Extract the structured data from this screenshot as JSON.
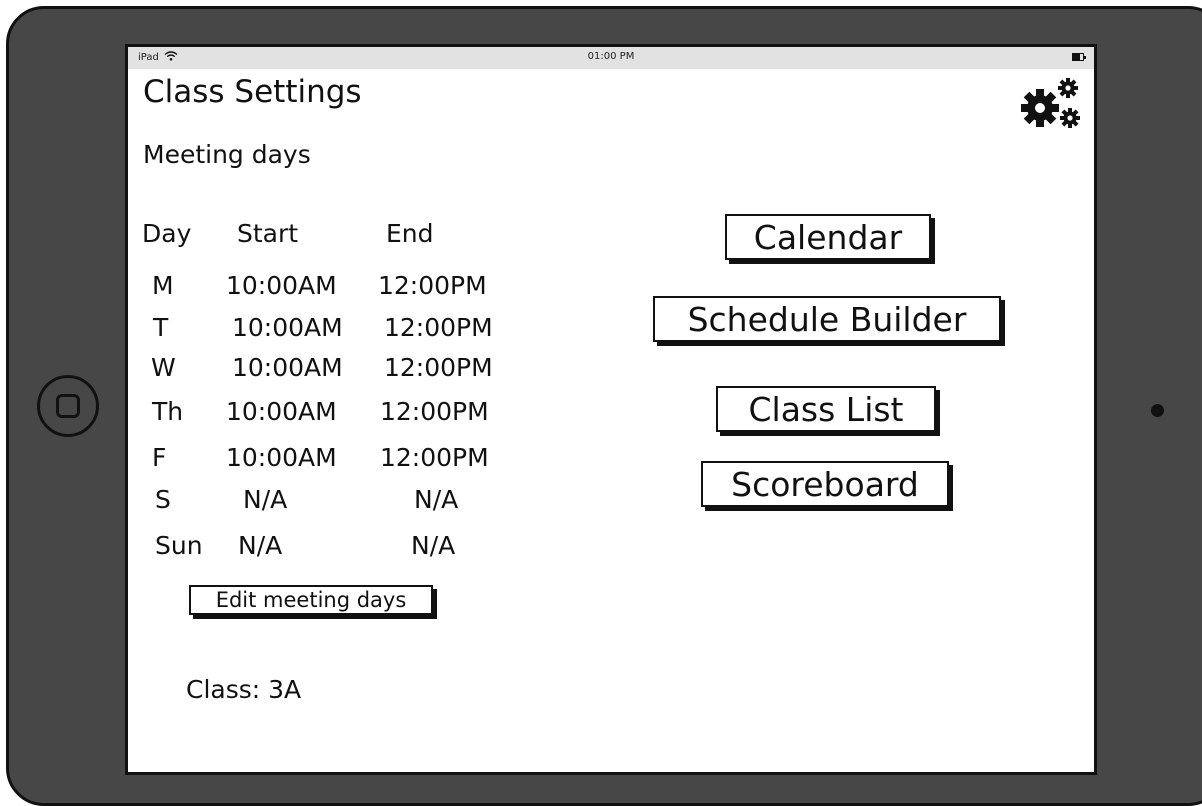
{
  "status_bar": {
    "carrier": "iPad",
    "time": "01:00 PM"
  },
  "header": {
    "title": "Class Settings"
  },
  "meeting": {
    "section_title": "Meeting days",
    "columns": [
      "Day",
      "Start",
      "End"
    ],
    "rows": [
      {
        "day": "M",
        "start": "10:00AM",
        "end": "12:00PM"
      },
      {
        "day": "T",
        "start": "10:00AM",
        "end": "12:00PM"
      },
      {
        "day": "W",
        "start": "10:00AM",
        "end": "12:00PM"
      },
      {
        "day": "Th",
        "start": "10:00AM",
        "end": "12:00PM"
      },
      {
        "day": "F",
        "start": "10:00AM",
        "end": "12:00PM"
      },
      {
        "day": "S",
        "start": "N/A",
        "end": "N/A"
      },
      {
        "day": "Sun",
        "start": "N/A",
        "end": "N/A"
      }
    ],
    "edit_label": "Edit meeting days"
  },
  "nav": {
    "calendar_label": "Calendar",
    "schedule_builder_label": "Schedule Builder",
    "class_list_label": "Class List",
    "scoreboard_label": "Scoreboard"
  },
  "footer": {
    "class_label": "Class: 3A"
  },
  "icons": {
    "settings": "gear-icon",
    "wifi": "wifi-icon",
    "battery": "battery-icon",
    "home": "home-button"
  }
}
